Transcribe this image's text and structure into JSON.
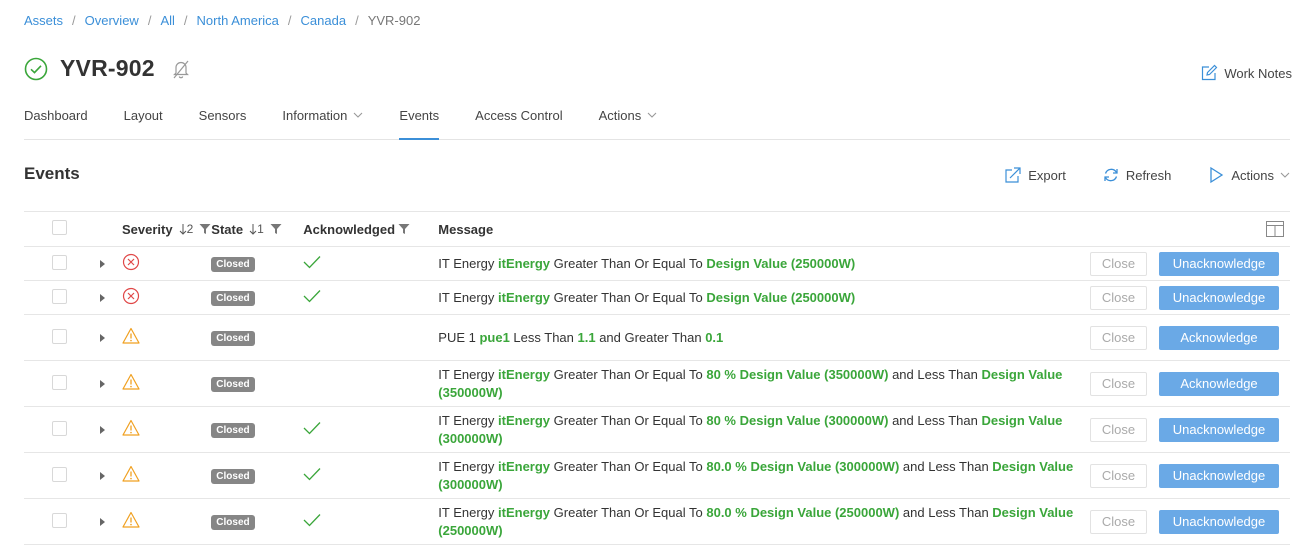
{
  "breadcrumb": {
    "items": [
      "Assets",
      "Overview",
      "All",
      "North America",
      "Canada"
    ],
    "current": "YVR-902"
  },
  "page": {
    "title": "YVR-902",
    "work_notes_label": "Work Notes"
  },
  "tabs": [
    {
      "label": "Dashboard",
      "dropdown": false
    },
    {
      "label": "Layout",
      "dropdown": false
    },
    {
      "label": "Sensors",
      "dropdown": false
    },
    {
      "label": "Information",
      "dropdown": true
    },
    {
      "label": "Events",
      "dropdown": false,
      "active": true
    },
    {
      "label": "Access Control",
      "dropdown": false
    },
    {
      "label": "Actions",
      "dropdown": true
    }
  ],
  "section": {
    "title": "Events",
    "export_label": "Export",
    "refresh_label": "Refresh",
    "actions_label": "Actions"
  },
  "table": {
    "columns": {
      "severity": "Severity",
      "severity_sort": "2",
      "state": "State",
      "state_sort": "1",
      "acknowledged": "Acknowledged",
      "message": "Message"
    },
    "close_label": "Close",
    "rows": [
      {
        "severity": "critical",
        "state": "Closed",
        "acknowledged": true,
        "message": [
          {
            "t": "IT Energy "
          },
          {
            "t": "itEnergy",
            "h": true
          },
          {
            "t": " Greater Than Or Equal To "
          },
          {
            "t": "Design Value (250000W)",
            "h": true
          }
        ],
        "action": "Unacknowledge"
      },
      {
        "severity": "critical",
        "state": "Closed",
        "acknowledged": true,
        "message": [
          {
            "t": "IT Energy "
          },
          {
            "t": "itEnergy",
            "h": true
          },
          {
            "t": " Greater Than Or Equal To "
          },
          {
            "t": "Design Value (250000W)",
            "h": true
          }
        ],
        "action": "Unacknowledge"
      },
      {
        "severity": "warning",
        "state": "Closed",
        "acknowledged": false,
        "message": [
          {
            "t": "PUE 1 "
          },
          {
            "t": "pue1",
            "h": true
          },
          {
            "t": " Less Than "
          },
          {
            "t": "1.1",
            "h": true
          },
          {
            "t": " and Greater Than "
          },
          {
            "t": "0.1",
            "h": true
          }
        ],
        "action": "Acknowledge"
      },
      {
        "severity": "warning",
        "state": "Closed",
        "acknowledged": false,
        "message": [
          {
            "t": "IT Energy "
          },
          {
            "t": "itEnergy",
            "h": true
          },
          {
            "t": " Greater Than Or Equal To "
          },
          {
            "t": "80 % Design Value (350000W)",
            "h": true
          },
          {
            "t": " and Less Than "
          },
          {
            "t": "Design Value (350000W)",
            "h": true
          }
        ],
        "action": "Acknowledge"
      },
      {
        "severity": "warning",
        "state": "Closed",
        "acknowledged": true,
        "message": [
          {
            "t": "IT Energy "
          },
          {
            "t": "itEnergy",
            "h": true
          },
          {
            "t": " Greater Than Or Equal To "
          },
          {
            "t": "80 % Design Value (300000W)",
            "h": true
          },
          {
            "t": " and Less Than "
          },
          {
            "t": "Design Value (300000W)",
            "h": true
          }
        ],
        "action": "Unacknowledge"
      },
      {
        "severity": "warning",
        "state": "Closed",
        "acknowledged": true,
        "message": [
          {
            "t": "IT Energy "
          },
          {
            "t": "itEnergy",
            "h": true
          },
          {
            "t": " Greater Than Or Equal To "
          },
          {
            "t": "80.0 % Design Value (300000W)",
            "h": true
          },
          {
            "t": " and Less Than "
          },
          {
            "t": "Design Value (300000W)",
            "h": true
          }
        ],
        "action": "Unacknowledge"
      },
      {
        "severity": "warning",
        "state": "Closed",
        "acknowledged": true,
        "message": [
          {
            "t": "IT Energy "
          },
          {
            "t": "itEnergy",
            "h": true
          },
          {
            "t": " Greater Than Or Equal To "
          },
          {
            "t": "80.0 % Design Value (250000W)",
            "h": true
          },
          {
            "t": " and Less Than "
          },
          {
            "t": "Design Value (250000W)",
            "h": true
          }
        ],
        "action": "Unacknowledge"
      }
    ]
  },
  "colors": {
    "link": "#3b8fd8",
    "ok": "#3aa63a",
    "critical": "#e04848",
    "warning": "#f0a020",
    "primary_button": "#6aa9e6",
    "badge": "#868686"
  },
  "icons": {
    "status": "check-circle-icon",
    "alarm": "bell-slash-icon",
    "work_notes": "edit-icon",
    "export": "export-icon",
    "refresh": "refresh-icon",
    "actions": "play-icon",
    "columns": "columns-icon",
    "filter": "filter-icon",
    "sort": "sort-down-icon",
    "critical": "x-circle-icon",
    "warning": "warning-triangle-icon",
    "ack": "check-icon",
    "expand": "caret-right-icon"
  }
}
